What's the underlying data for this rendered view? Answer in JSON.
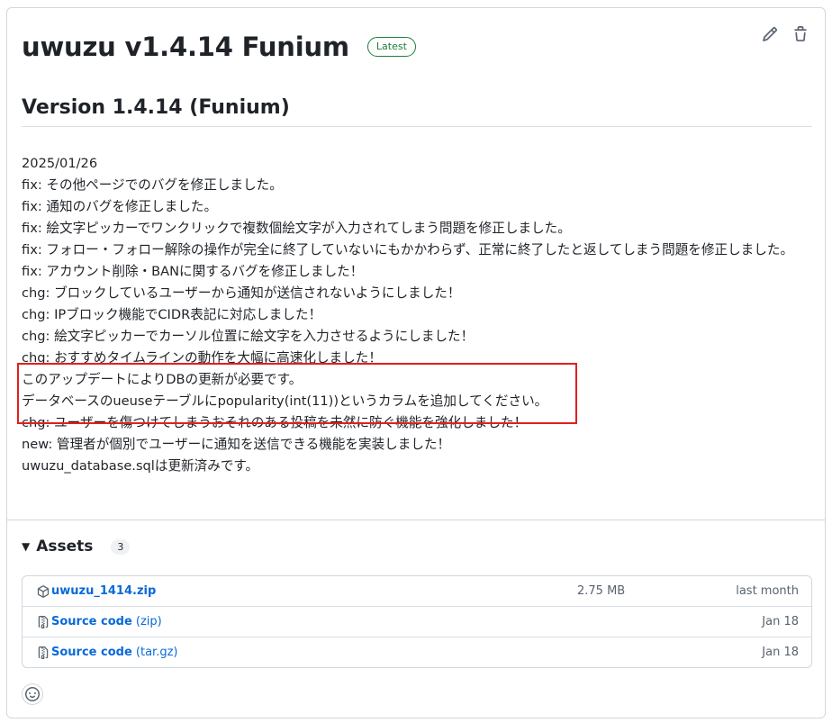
{
  "release": {
    "title": "uwuzu v1.4.14 Funium",
    "badge": "Latest",
    "version_heading": "Version 1.4.14 (Funium)"
  },
  "actions": {
    "edit_icon": "pencil-icon",
    "delete_icon": "trash-icon"
  },
  "notes": [
    "2025/01/26",
    "fix: その他ページでのバグを修正しました。",
    "fix: 通知のバグを修正しました。",
    "fix: 絵文字ピッカーでワンクリックで複数個絵文字が入力されてしまう問題を修正しました。",
    "fix: フォロー・フォロー解除の操作が完全に終了していないにもかかわらず、正常に終了したと返してしまう問題を修正しました。",
    "fix: アカウント削除・BANに関するバグを修正しました！",
    "chg: ブロックしているユーザーから通知が送信されないようにしました！",
    "chg: IPブロック機能でCIDR表記に対応しました！",
    "chg: 絵文字ピッカーでカーソル位置に絵文字を入力させるようにしました！",
    "chg: おすすめタイムラインの動作を大幅に高速化しました！",
    "このアップデートによりDBの更新が必要です。",
    "データベースのueuseテーブルにpopularity(int(11))というカラムを追加してください。",
    "chg: ユーザーを傷つけてしまうおそれのある投稿を未然に防ぐ機能を強化しました！",
    "new: 管理者が個別でユーザーに通知を送信できる機能を実装しました！",
    "uwuzu_database.sqlは更新済みです。"
  ],
  "assets": {
    "title": "Assets",
    "count": "3",
    "items": [
      {
        "name": "uwuzu_1414.zip",
        "suffix": "",
        "size": "2.75 MB",
        "date": "last month",
        "icon": "package-icon"
      },
      {
        "name": "Source code",
        "suffix": " (zip)",
        "size": "",
        "date": "Jan 18",
        "icon": "file-zip-icon"
      },
      {
        "name": "Source code",
        "suffix": " (tar.gz)",
        "size": "",
        "date": "Jan 18",
        "icon": "file-zip-icon"
      }
    ]
  },
  "colors": {
    "link": "#0969da",
    "badge": "#1a7f37",
    "highlight": "#e0201e",
    "border": "#d0d7de"
  }
}
